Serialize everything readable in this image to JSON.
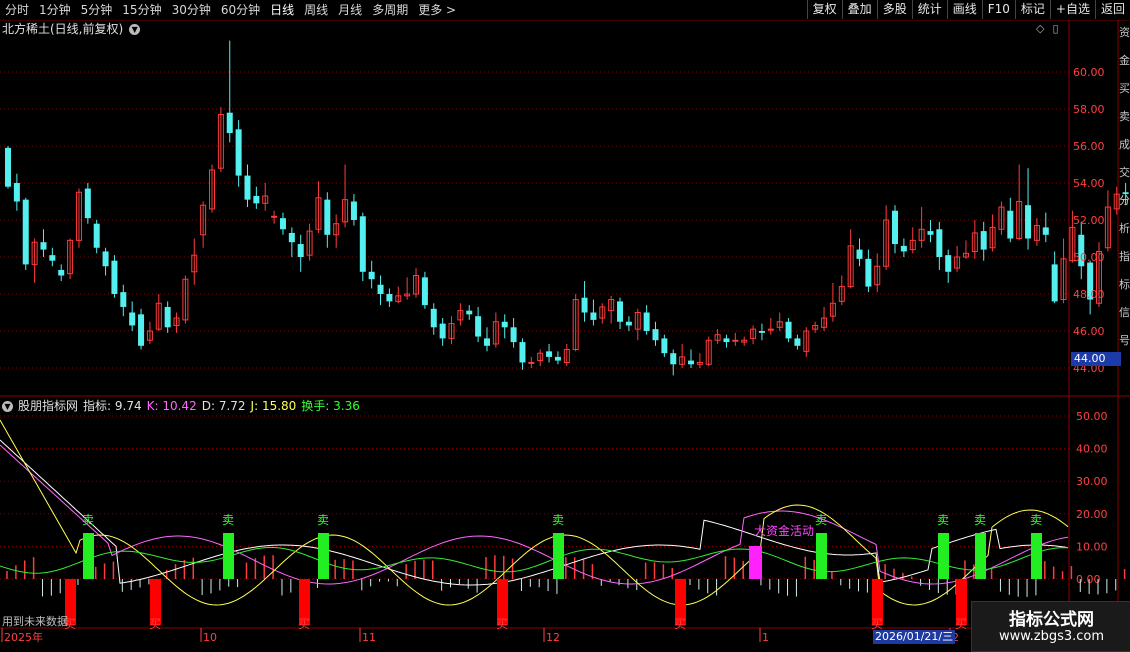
{
  "toolbar": {
    "periods": [
      "分时",
      "1分钟",
      "5分钟",
      "15分钟",
      "30分钟",
      "60分钟",
      "日线",
      "周线",
      "月线",
      "多周期",
      "更多 >"
    ],
    "active_period": "日线",
    "right_buttons": [
      "复权",
      "叠加",
      "多股",
      "统计",
      "画线",
      "F10",
      "标记",
      "+自选",
      "返回"
    ]
  },
  "title": {
    "stock": "北方稀土(日线,前复权)"
  },
  "price_axis": {
    "labels": [
      "60.00",
      "58.00",
      "56.00",
      "54.00",
      "52.00",
      "50.00",
      "48.00",
      "46.00",
      "44.00"
    ],
    "current_tag": "44.00"
  },
  "right_vertical_text": "资金买卖成交分析指标信号",
  "indicator": {
    "name": "股朋指标网",
    "metrics": [
      {
        "label": "指标:",
        "value": "9.74",
        "color": "#e0e0e0"
      },
      {
        "label": "K:",
        "value": "10.42",
        "color": "#ff66ff"
      },
      {
        "label": "D:",
        "value": "7.72",
        "color": "#e0e0e0"
      },
      {
        "label": "J:",
        "value": "15.80",
        "color": "#ffff55"
      },
      {
        "label": "换手:",
        "value": "3.36",
        "color": "#33ff33"
      }
    ],
    "axis_labels": [
      "50.00",
      "40.00",
      "30.00",
      "20.00",
      "10.00",
      "0.00"
    ],
    "sell_label": "卖",
    "buy_label": "买",
    "big_money_label": "大资金活动"
  },
  "time_axis": {
    "labels": [
      "2025年",
      "10",
      "11",
      "12",
      "1",
      "2"
    ],
    "cursor_date": "2026/01/21/三"
  },
  "footer_note": "用到未来数据",
  "watermark": {
    "title": "指标公式网",
    "url": "www.zbgs3.com"
  },
  "colors": {
    "up": "#ff3b3b",
    "down": "#54f0f0",
    "sell_bar": "#22ee22",
    "buy_bar": "#ff0000",
    "big_money": "#ff22ff",
    "grid": "#8b0000"
  },
  "chart_data": {
    "type": "candlestick",
    "ylim": [
      43,
      62
    ],
    "candles": [
      [
        55.9,
        53.8,
        56.0,
        53.7
      ],
      [
        54.0,
        53.0,
        54.5,
        52.5
      ],
      [
        53.1,
        49.6,
        53.2,
        49.3
      ],
      [
        49.6,
        50.8,
        51.0,
        48.6
      ],
      [
        50.8,
        50.4,
        51.5,
        50.0
      ],
      [
        50.1,
        49.8,
        50.5,
        49.5
      ],
      [
        49.3,
        49.0,
        49.6,
        48.7
      ],
      [
        49.1,
        50.9,
        51.0,
        48.8
      ],
      [
        50.9,
        53.5,
        53.7,
        50.5
      ],
      [
        53.7,
        52.1,
        54.0,
        51.8
      ],
      [
        51.8,
        50.5,
        52.0,
        50.2
      ],
      [
        50.3,
        49.5,
        50.5,
        49.0
      ],
      [
        49.8,
        48.0,
        50.1,
        47.8
      ],
      [
        48.1,
        47.3,
        48.5,
        46.8
      ],
      [
        47.0,
        46.3,
        47.6,
        46.0
      ],
      [
        46.9,
        45.2,
        47.2,
        45.0
      ],
      [
        45.5,
        46.0,
        46.5,
        45.3
      ],
      [
        46.1,
        47.5,
        48.0,
        46.0
      ],
      [
        47.3,
        46.2,
        47.6,
        45.9
      ],
      [
        46.3,
        46.7,
        47.0,
        45.9
      ],
      [
        46.6,
        48.8,
        49.0,
        46.4
      ],
      [
        49.2,
        50.1,
        51.0,
        48.5
      ],
      [
        51.2,
        52.8,
        53.0,
        50.5
      ],
      [
        52.6,
        54.7,
        55.0,
        52.4
      ],
      [
        54.8,
        57.7,
        58.1,
        54.6
      ],
      [
        57.8,
        56.7,
        61.7,
        56.2
      ],
      [
        56.9,
        54.4,
        57.4,
        53.8
      ],
      [
        54.4,
        53.1,
        55.0,
        52.7
      ],
      [
        53.3,
        52.9,
        53.8,
        52.6
      ],
      [
        52.9,
        53.3,
        54.0,
        52.5
      ],
      [
        52.2,
        52.2,
        52.5,
        51.8
      ],
      [
        52.1,
        51.5,
        52.4,
        51.2
      ],
      [
        51.3,
        50.8,
        51.6,
        50.0
      ],
      [
        50.7,
        50.0,
        51.2,
        49.2
      ],
      [
        50.1,
        51.4,
        51.8,
        49.8
      ],
      [
        51.5,
        53.2,
        54.1,
        51.3
      ],
      [
        53.1,
        51.2,
        53.5,
        50.5
      ],
      [
        51.2,
        51.8,
        52.3,
        50.5
      ],
      [
        51.9,
        53.1,
        55.0,
        51.6
      ],
      [
        53.0,
        52.0,
        53.4,
        51.7
      ],
      [
        52.2,
        49.2,
        52.4,
        48.7
      ],
      [
        49.2,
        48.8,
        49.8,
        48.3
      ],
      [
        48.5,
        48.0,
        49.0,
        47.4
      ],
      [
        48.0,
        47.6,
        48.3,
        47.3
      ],
      [
        47.6,
        47.9,
        48.4,
        47.5
      ],
      [
        47.9,
        48.0,
        48.9,
        47.7
      ],
      [
        48.0,
        49.0,
        49.4,
        47.8
      ],
      [
        48.9,
        47.4,
        49.2,
        47.2
      ],
      [
        47.2,
        46.2,
        47.5,
        45.8
      ],
      [
        46.4,
        45.6,
        46.7,
        45.2
      ],
      [
        45.6,
        46.4,
        46.8,
        45.3
      ],
      [
        46.6,
        47.1,
        47.5,
        46.3
      ],
      [
        47.1,
        46.9,
        47.4,
        46.6
      ],
      [
        46.8,
        45.7,
        47.3,
        45.4
      ],
      [
        45.6,
        45.2,
        46.2,
        44.9
      ],
      [
        45.3,
        46.5,
        47.0,
        45.1
      ],
      [
        46.5,
        46.2,
        46.9,
        45.6
      ],
      [
        46.2,
        45.4,
        46.7,
        45.1
      ],
      [
        45.4,
        44.3,
        45.6,
        43.9
      ],
      [
        44.3,
        44.3,
        44.6,
        44.0
      ],
      [
        44.4,
        44.8,
        45.0,
        44.1
      ],
      [
        44.9,
        44.6,
        45.3,
        44.3
      ],
      [
        44.6,
        44.4,
        44.9,
        44.2
      ],
      [
        44.3,
        45.0,
        45.3,
        44.1
      ],
      [
        45.0,
        47.7,
        48.0,
        44.9
      ],
      [
        47.8,
        47.0,
        48.7,
        46.5
      ],
      [
        47.0,
        46.6,
        47.7,
        46.3
      ],
      [
        46.7,
        47.3,
        47.5,
        46.4
      ],
      [
        47.1,
        47.7,
        47.9,
        46.4
      ],
      [
        47.6,
        46.5,
        47.8,
        46.1
      ],
      [
        46.5,
        46.3,
        46.8,
        46.0
      ],
      [
        46.1,
        47.0,
        47.2,
        45.5
      ],
      [
        47.0,
        46.0,
        47.4,
        45.8
      ],
      [
        46.1,
        45.5,
        46.5,
        45.2
      ],
      [
        45.6,
        44.8,
        45.8,
        44.6
      ],
      [
        44.8,
        44.2,
        45.0,
        43.6
      ],
      [
        44.2,
        44.6,
        45.3,
        44.0
      ],
      [
        44.4,
        44.2,
        45.0,
        44.0
      ],
      [
        44.2,
        44.3,
        44.8,
        44.0
      ],
      [
        44.2,
        45.5,
        45.7,
        44.1
      ],
      [
        45.5,
        45.8,
        46.1,
        45.3
      ],
      [
        45.6,
        45.4,
        45.8,
        45.1
      ],
      [
        45.5,
        45.5,
        45.9,
        45.2
      ],
      [
        45.4,
        45.5,
        45.7,
        45.2
      ],
      [
        45.6,
        46.1,
        46.3,
        45.3
      ],
      [
        46.0,
        45.9,
        46.4,
        45.5
      ],
      [
        46.1,
        46.1,
        46.7,
        45.8
      ],
      [
        46.2,
        46.5,
        47.0,
        46.0
      ],
      [
        46.5,
        45.6,
        46.7,
        45.4
      ],
      [
        45.6,
        45.2,
        45.8,
        45.0
      ],
      [
        44.9,
        46.0,
        46.2,
        44.6
      ],
      [
        46.1,
        46.3,
        46.5,
        45.9
      ],
      [
        46.2,
        46.7,
        47.3,
        46.0
      ],
      [
        46.8,
        47.5,
        48.6,
        46.5
      ],
      [
        47.6,
        48.4,
        49.0,
        47.4
      ],
      [
        48.4,
        50.6,
        51.5,
        48.3
      ],
      [
        50.4,
        49.9,
        51.0,
        49.5
      ],
      [
        49.9,
        48.4,
        50.4,
        48.1
      ],
      [
        48.5,
        49.5,
        50.2,
        48.1
      ],
      [
        49.5,
        52.0,
        52.8,
        49.3
      ],
      [
        52.5,
        50.7,
        52.8,
        50.2
      ],
      [
        50.6,
        50.3,
        51.0,
        50.0
      ],
      [
        50.4,
        50.9,
        51.6,
        50.2
      ],
      [
        50.9,
        51.5,
        52.7,
        50.5
      ],
      [
        51.4,
        51.2,
        52.0,
        50.8
      ],
      [
        51.5,
        50.0,
        51.9,
        49.3
      ],
      [
        50.1,
        49.2,
        50.4,
        48.6
      ],
      [
        49.4,
        50.0,
        50.6,
        49.2
      ],
      [
        50.0,
        50.2,
        50.9,
        49.9
      ],
      [
        50.3,
        51.3,
        52.0,
        49.9
      ],
      [
        51.4,
        50.4,
        51.9,
        49.8
      ],
      [
        50.5,
        51.6,
        52.3,
        50.3
      ],
      [
        51.5,
        52.7,
        53.0,
        51.2
      ],
      [
        52.5,
        51.0,
        53.2,
        50.8
      ],
      [
        51.0,
        53.0,
        55.0,
        50.9
      ],
      [
        52.8,
        51.0,
        54.8,
        50.4
      ],
      [
        50.9,
        51.7,
        52.1,
        50.6
      ],
      [
        51.6,
        51.2,
        52.4,
        50.8
      ],
      [
        49.6,
        47.6,
        50.3,
        47.5
      ],
      [
        47.7,
        49.9,
        51.0,
        47.5
      ],
      [
        49.8,
        51.6,
        52.5,
        49.7
      ],
      [
        51.2,
        49.5,
        51.9,
        48.8
      ],
      [
        49.7,
        47.7,
        49.8,
        46.9
      ],
      [
        47.5,
        50.3,
        50.8,
        47.3
      ],
      [
        50.5,
        52.7,
        53.6,
        50.3
      ],
      [
        52.6,
        53.4,
        53.8,
        52.3
      ],
      [
        53.5,
        53.4,
        54.0,
        52.8
      ],
      [
        53.2,
        55.6,
        58.4,
        53.0
      ],
      [
        55.5,
        57.4,
        57.6,
        55.1
      ],
      [
        56.8,
        54.6,
        57.0,
        54.3
      ]
    ]
  }
}
